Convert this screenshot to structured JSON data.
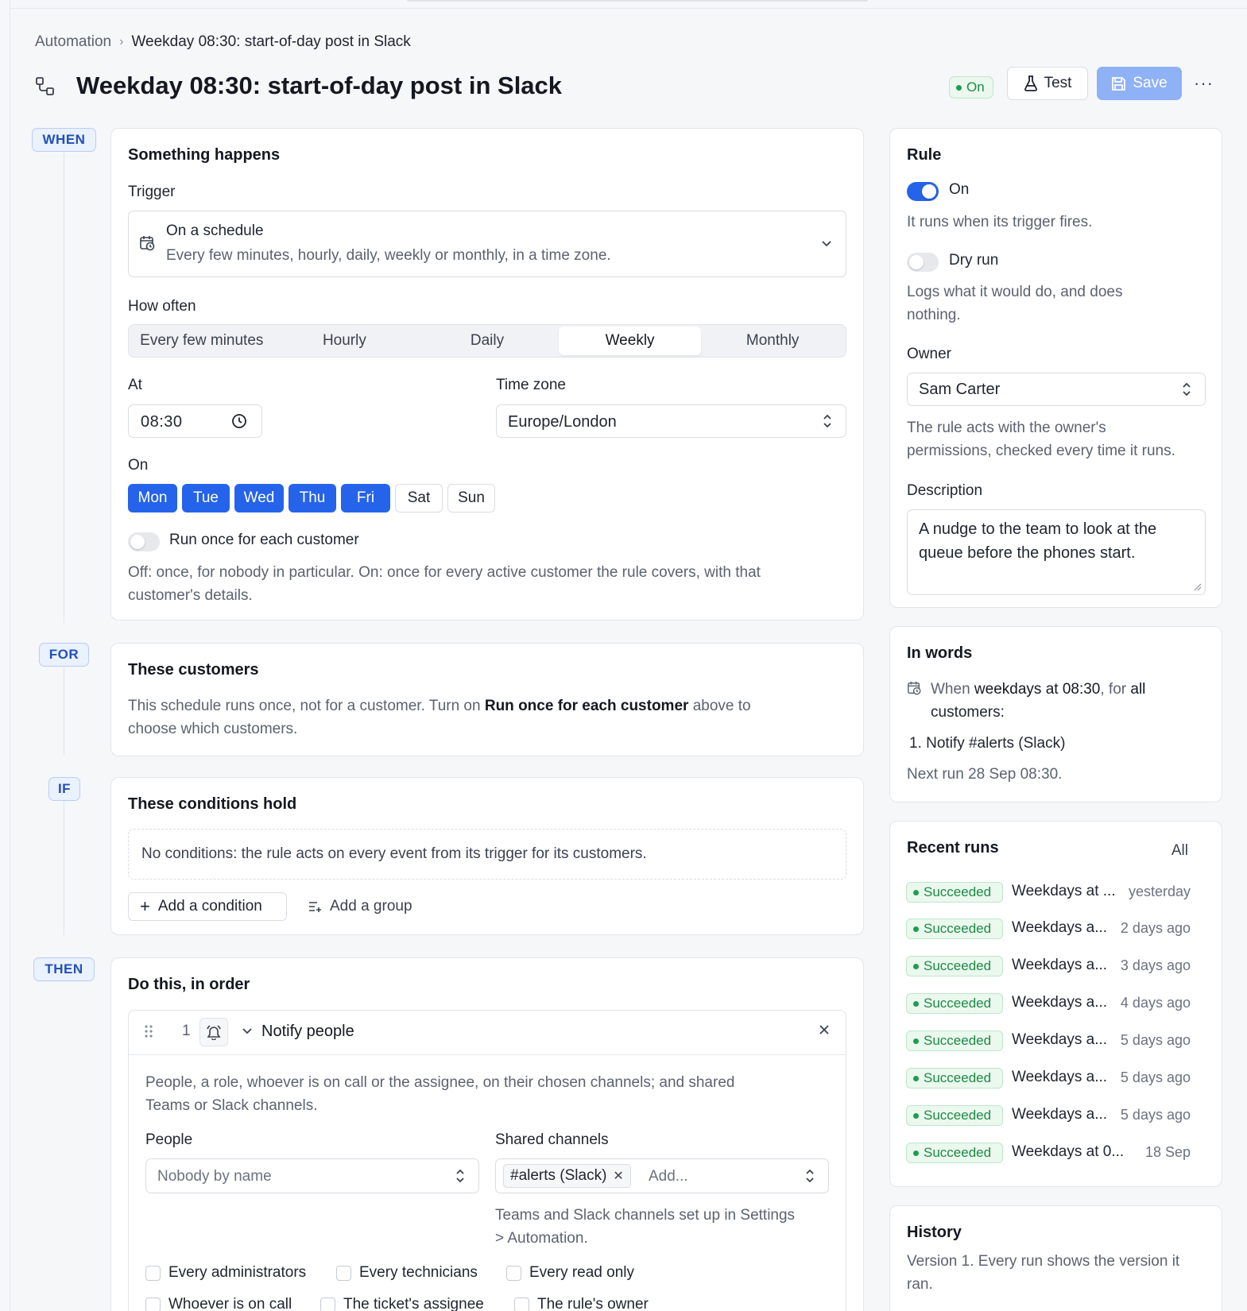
{
  "breadcrumb": {
    "root": "Automation",
    "current": "Weekday 08:30: start-of-day post in Slack"
  },
  "header": {
    "title": "Weekday 08:30: start-of-day post in Slack",
    "status": "On",
    "test_label": "Test",
    "save_label": "Save"
  },
  "rail": {
    "when": "WHEN",
    "for": "FOR",
    "if": "IF",
    "then": "THEN"
  },
  "when_card": {
    "title": "Something happens",
    "trigger_label": "Trigger",
    "trigger_name": "On a schedule",
    "trigger_desc": "Every few minutes, hourly, daily, weekly or monthly, in a time zone.",
    "how_often_label": "How often",
    "frequencies": [
      "Every few minutes",
      "Hourly",
      "Daily",
      "Weekly",
      "Monthly"
    ],
    "frequency_selected": "Weekly",
    "at_label": "At",
    "at_value": "08:30",
    "timezone_label": "Time zone",
    "timezone_value": "Europe/London",
    "on_label": "On",
    "days": [
      {
        "label": "Mon",
        "on": true
      },
      {
        "label": "Tue",
        "on": true
      },
      {
        "label": "Wed",
        "on": true
      },
      {
        "label": "Thu",
        "on": true
      },
      {
        "label": "Fri",
        "on": true
      },
      {
        "label": "Sat",
        "on": false
      },
      {
        "label": "Sun",
        "on": false
      }
    ],
    "per_customer_label": "Run once for each customer",
    "per_customer_help_1": "Off: once, for nobody in particular. On: once for every active customer the rule covers, with that",
    "per_customer_help_2": "customer's details."
  },
  "for_card": {
    "title": "These customers",
    "text_a": "This schedule runs once, not for a customer. Turn on ",
    "text_bold": "Run once for each customer",
    "text_b": " above to",
    "text_c": "choose which customers."
  },
  "if_card": {
    "title": "These conditions hold",
    "empty_text": "No conditions: the rule acts on every event from its trigger for its customers.",
    "add_condition": "Add a condition",
    "add_group": "Add a group"
  },
  "then_card": {
    "title": "Do this, in order",
    "action_index": "1",
    "action_name": "Notify people",
    "action_desc_1": "People, a role, whoever is on call or the assignee, on their chosen channels; and shared",
    "action_desc_2": "Teams or Slack channels.",
    "people_label": "People",
    "people_placeholder": "Nobody by name",
    "channels_label": "Shared channels",
    "channel_chip": "#alerts (Slack)",
    "channel_placeholder": "Add...",
    "channels_help_1": "Teams and Slack channels set up in Settings",
    "channels_help_2": "> Automation.",
    "checks_row1": [
      "Every administrators",
      "Every technicians",
      "Every read only"
    ],
    "checks_row2": [
      "Whoever is on call",
      "The ticket's assignee",
      "The rule's owner"
    ]
  },
  "rule_card": {
    "title": "Rule",
    "on_label": "On",
    "on_help": "It runs when its trigger fires.",
    "dry_label": "Dry run",
    "dry_help_1": "Logs what it would do, and does",
    "dry_help_2": "nothing.",
    "owner_label": "Owner",
    "owner_value": "Sam Carter",
    "owner_help_1": "The rule acts with the owner's",
    "owner_help_2": "permissions, checked every time it runs.",
    "description_label": "Description",
    "description_value_1": "A nudge to the team to look at the",
    "description_value_2": "queue before the phones start."
  },
  "words_card": {
    "title": "In words",
    "when_a": "When ",
    "when_b": "weekdays at 08:30",
    "when_c": ", for ",
    "when_d": "all",
    "when_e": "customers:",
    "step": "1. Notify #alerts (Slack)",
    "next_run": "Next run 28 Sep 08:30."
  },
  "runs_card": {
    "title": "Recent runs",
    "all_link": "All",
    "runs": [
      {
        "status": "Succeeded",
        "name": "Weekdays at ...",
        "when": "yesterday"
      },
      {
        "status": "Succeeded",
        "name": "Weekdays a...",
        "when": "2 days ago"
      },
      {
        "status": "Succeeded",
        "name": "Weekdays a...",
        "when": "3 days ago"
      },
      {
        "status": "Succeeded",
        "name": "Weekdays a...",
        "when": "4 days ago"
      },
      {
        "status": "Succeeded",
        "name": "Weekdays a...",
        "when": "5 days ago"
      },
      {
        "status": "Succeeded",
        "name": "Weekdays a...",
        "when": "5 days ago"
      },
      {
        "status": "Succeeded",
        "name": "Weekdays a...",
        "when": "5 days ago"
      },
      {
        "status": "Succeeded",
        "name": "Weekdays at 0...",
        "when": "18 Sep"
      }
    ]
  },
  "history_card": {
    "title": "History",
    "text_1": "Version 1. Every run shows the version it",
    "text_2": "ran."
  },
  "colors": {
    "accent": "#2563eb",
    "success": "#1d8a45",
    "save_disabled": "#8fb1f5"
  }
}
